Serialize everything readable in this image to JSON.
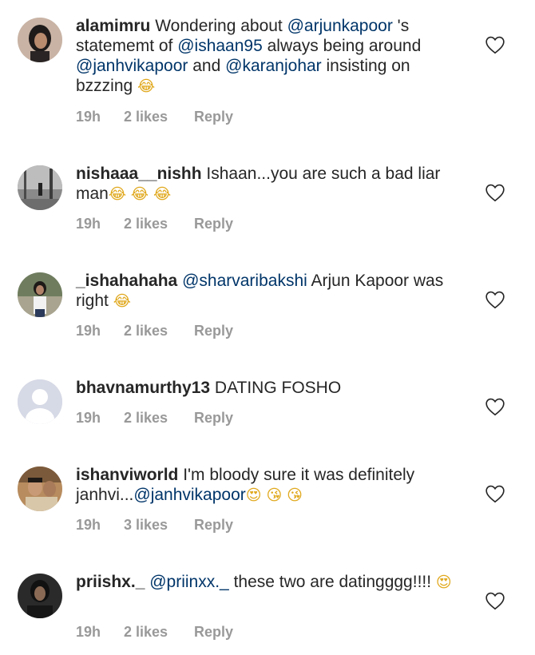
{
  "comments": [
    {
      "username": "alamimru",
      "parts": [
        {
          "t": "text",
          "v": " Wondering about "
        },
        {
          "t": "mention",
          "v": "@arjunkapoor"
        },
        {
          "t": "text",
          "v": " 's statememt of "
        },
        {
          "t": "mention",
          "v": "@ishaan95"
        },
        {
          "t": "text",
          "v": " always being around "
        },
        {
          "t": "mention",
          "v": "@janhvikapoor"
        },
        {
          "t": "text",
          "v": " and "
        },
        {
          "t": "mention",
          "v": "@karanjohar"
        },
        {
          "t": "text",
          "v": " insisting on bzzzing "
        },
        {
          "t": "emoji",
          "v": "😂"
        }
      ],
      "time": "19h",
      "likes": "2 likes",
      "reply": "Reply",
      "avatar": "woman-dark-hair-avatar"
    },
    {
      "username": "nishaaa__nishh",
      "parts": [
        {
          "t": "text",
          "v": " Ishaan...you are such a bad liar man"
        },
        {
          "t": "emoji",
          "v": "😂"
        },
        {
          "t": "text",
          "v": " "
        },
        {
          "t": "emoji",
          "v": "😂"
        },
        {
          "t": "text",
          "v": " "
        },
        {
          "t": "emoji",
          "v": "😂"
        }
      ],
      "time": "19h",
      "likes": "2 likes",
      "reply": "Reply",
      "avatar": "grey-street-avatar"
    },
    {
      "username": "_ishahahaha",
      "parts": [
        {
          "t": "text",
          "v": " "
        },
        {
          "t": "mention",
          "v": "@sharvaribakshi"
        },
        {
          "t": "text",
          "v": " Arjun Kapoor was right "
        },
        {
          "t": "emoji",
          "v": "😂"
        }
      ],
      "time": "19h",
      "likes": "2 likes",
      "reply": "Reply",
      "avatar": "woman-outdoor-avatar"
    },
    {
      "username": "bhavnamurthy13",
      "parts": [
        {
          "t": "text",
          "v": " DATING FOSHO"
        }
      ],
      "time": "19h",
      "likes": "2 likes",
      "reply": "Reply",
      "avatar": "default-user-avatar"
    },
    {
      "username": "ishanviworld",
      "parts": [
        {
          "t": "text",
          "v": " I'm bloody sure it was definitely janhvi..."
        },
        {
          "t": "mention",
          "v": "@janhvikapoor"
        },
        {
          "t": "emoji",
          "v": "😍"
        },
        {
          "t": "text",
          "v": " "
        },
        {
          "t": "emoji",
          "v": "😘"
        },
        {
          "t": "text",
          "v": " "
        },
        {
          "t": "emoji",
          "v": "😘"
        }
      ],
      "time": "19h",
      "likes": "3 likes",
      "reply": "Reply",
      "avatar": "two-people-avatar"
    },
    {
      "username": "priishx._",
      "parts": [
        {
          "t": "text",
          "v": " "
        },
        {
          "t": "mention",
          "v": "@priinxx._"
        },
        {
          "t": "text",
          "v": " these two are datingggg!!!! "
        },
        {
          "t": "emoji",
          "v": "😍"
        }
      ],
      "time": "19h",
      "likes": "2 likes",
      "reply": "Reply",
      "avatar": "dark-portrait-avatar"
    }
  ],
  "colors": {
    "username": "#262626",
    "mention": "#003569",
    "meta": "#999999",
    "heart": "#262626"
  }
}
